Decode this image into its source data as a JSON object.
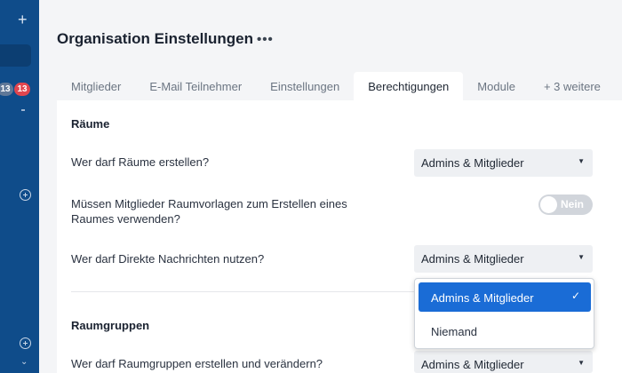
{
  "sidebar": {
    "badges": [
      "13",
      "13"
    ],
    "icons": [
      "plus-icon",
      "add-circle-icon",
      "chevron-down-icon"
    ]
  },
  "header": {
    "title": "Organisation Einstellungen",
    "more_label": "•••"
  },
  "tabs": [
    {
      "label": "Mitglieder"
    },
    {
      "label": "E-Mail Teilnehmer"
    },
    {
      "label": "Einstellungen"
    },
    {
      "label": "Berechtigungen",
      "active": true
    },
    {
      "label": "Module"
    },
    {
      "label": "+ 3 weitere"
    }
  ],
  "sections": {
    "rooms_title": "Räume",
    "q_create_rooms": "Wer darf Räume erstellen?",
    "q_create_rooms_value": "Admins & Mitglieder",
    "q_templates": "Müssen Mitglieder Raumvorlagen zum Erstellen eines Raumes verwenden?",
    "q_templates_toggle": "Nein",
    "q_direct": "Wer darf Direkte Nachrichten nutzen?",
    "q_direct_value": "Admins & Mitglieder",
    "groups_title": "Raumgruppen",
    "q_groups": "Wer darf Raumgruppen erstellen und verändern?",
    "q_groups_value": "Admins & Mitglieder"
  },
  "dropdown": {
    "options": [
      "Admins & Mitglieder",
      "Niemand"
    ],
    "selected": "Admins & Mitglieder"
  },
  "colors": {
    "sidebar": "#0f4c8a",
    "accent": "#1a6cd6",
    "badge_red": "#e0464f"
  }
}
